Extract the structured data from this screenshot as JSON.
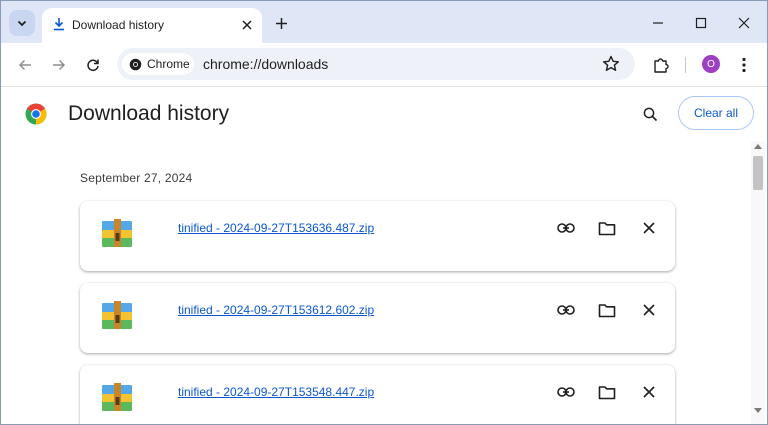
{
  "tab": {
    "title": "Download history"
  },
  "toolbar": {
    "chip_label": "Chrome",
    "url": "chrome://downloads",
    "avatar_letter": "O"
  },
  "page": {
    "title": "Download history",
    "clear_all_label": "Clear all"
  },
  "downloads": {
    "date": "September 27, 2024",
    "items": [
      {
        "filename": "tinified - 2024-09-27T153636.487.zip"
      },
      {
        "filename": "tinified - 2024-09-27T153612.602.zip"
      },
      {
        "filename": "tinified - 2024-09-27T153548.447.zip"
      }
    ]
  },
  "icons": {
    "tab_search": "chevron-down-icon",
    "tab_favicon": "download-icon",
    "file": "archive-icon",
    "copy_link": "link-icon",
    "show_in_folder": "folder-icon",
    "remove": "close-icon"
  },
  "colors": {
    "accent": "#0b57d0",
    "tabstrip": "#dfe7f7",
    "avatar": "#9c3fc2"
  }
}
